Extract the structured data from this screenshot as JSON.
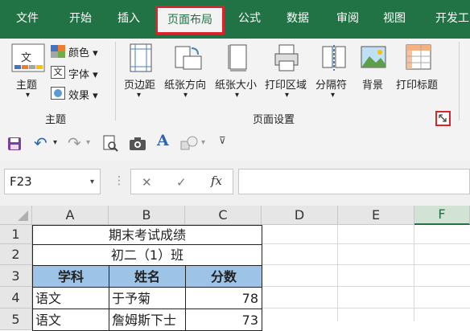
{
  "tabs": [
    "文件",
    "开始",
    "插入",
    "页面布局",
    "公式",
    "数据",
    "审阅",
    "视图",
    "开发工"
  ],
  "ribbon": {
    "theme_group": {
      "title": "主题",
      "theme_button": "主题",
      "colors": "颜色",
      "fonts": "字体",
      "effects": "效果"
    },
    "page_setup_group": {
      "title": "页面设置",
      "buttons": [
        "页边距",
        "纸张方向",
        "纸张大小",
        "打印区域",
        "分隔符",
        "背景",
        "打印标题"
      ]
    }
  },
  "namebox": "F23",
  "formula_bar": {
    "cancel": "✕",
    "enter": "✓",
    "fx": "fx",
    "value": ""
  },
  "columns": [
    "A",
    "B",
    "C",
    "D",
    "E",
    "F"
  ],
  "selected_column": "F",
  "rows": [
    "1",
    "2",
    "3",
    "4",
    "5"
  ],
  "sheet": {
    "title": "期末考试成绩",
    "subtitle": "初二（1）班",
    "headers": [
      "学科",
      "姓名",
      "分数"
    ],
    "data": [
      [
        "语文",
        "于予菊",
        "78"
      ],
      [
        "语文",
        "詹姆斯下士",
        "73"
      ]
    ]
  },
  "colors": {
    "accent": "#217346",
    "highlight": "#d8242a",
    "table_header": "#9dc3e6"
  }
}
